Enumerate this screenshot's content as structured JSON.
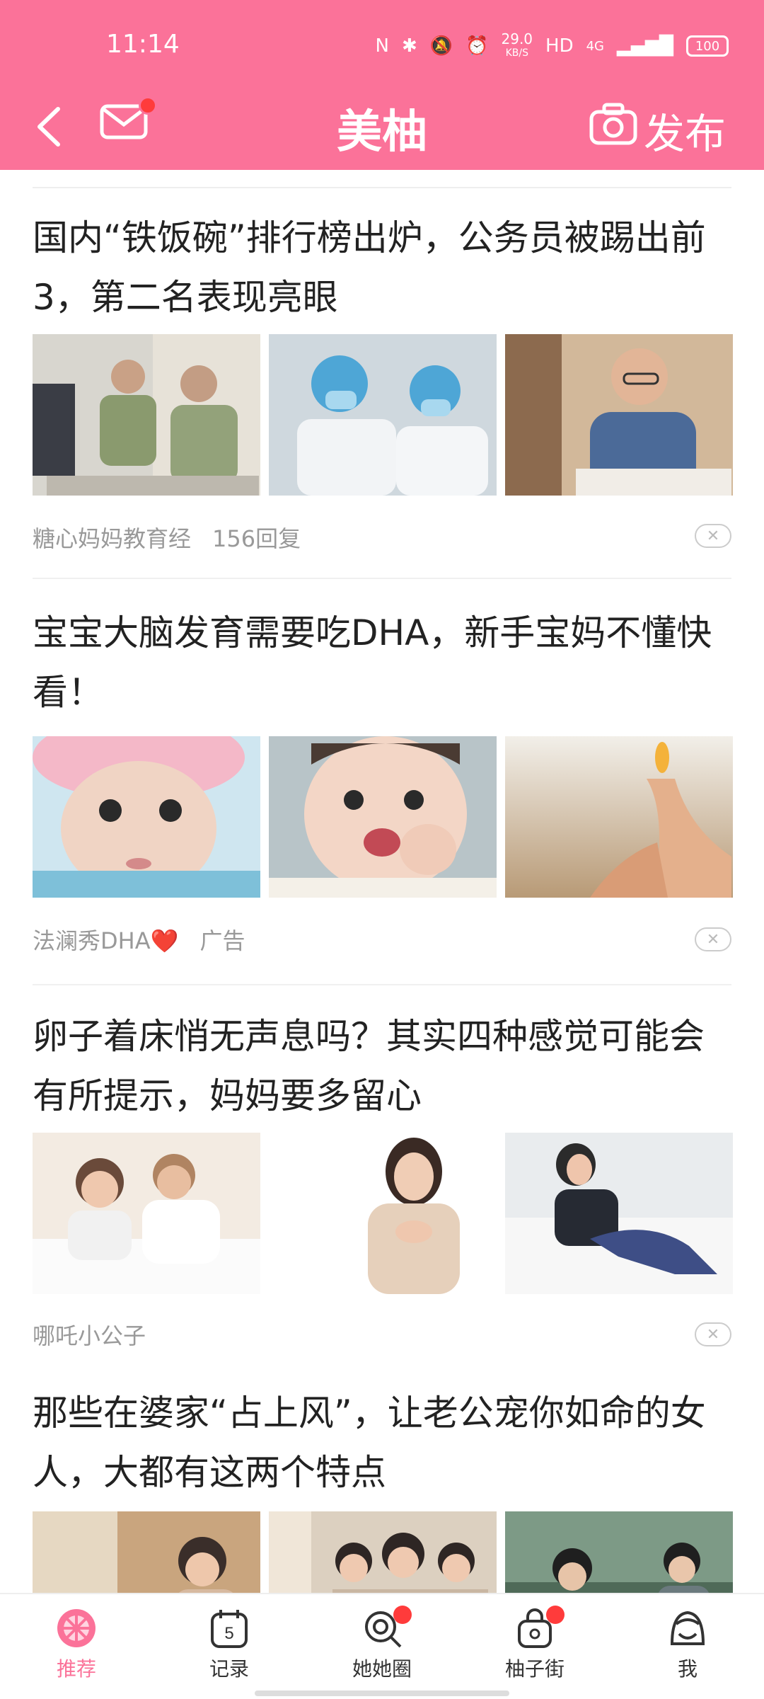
{
  "status": {
    "time": "11:14",
    "speed": "29.0",
    "speed_unit": "KB/S",
    "hd": "HD",
    "net": "4G",
    "battery": "100"
  },
  "nav": {
    "title": "美柚",
    "publish": "发布"
  },
  "posts": [
    {
      "title": "国内“铁饭碗”排行榜出炉，公务员被踢出前3，第二名表现亮眼",
      "source": "糖心妈妈教育经",
      "replies": "156回复"
    },
    {
      "title": "宝宝大脑发育需要吃DHA，新手宝妈不懂快看！",
      "source": "法澜秀DHA❤️",
      "tag": "广告"
    },
    {
      "title": "卵子着床悄无声息吗？其实四种感觉可能会有所提示，妈妈要多留心",
      "source": "哪吒小公子"
    },
    {
      "title": "那些在婆家“占上风”，让老公宠你如命的女人，大都有这两个特点"
    }
  ],
  "tabs": [
    {
      "label": "推荐"
    },
    {
      "label": "记录",
      "badge": "5"
    },
    {
      "label": "她她圈"
    },
    {
      "label": "柚子街"
    },
    {
      "label": "我"
    }
  ],
  "colors": {
    "brand": "#fb7299",
    "badge": "#ff3b3b"
  }
}
